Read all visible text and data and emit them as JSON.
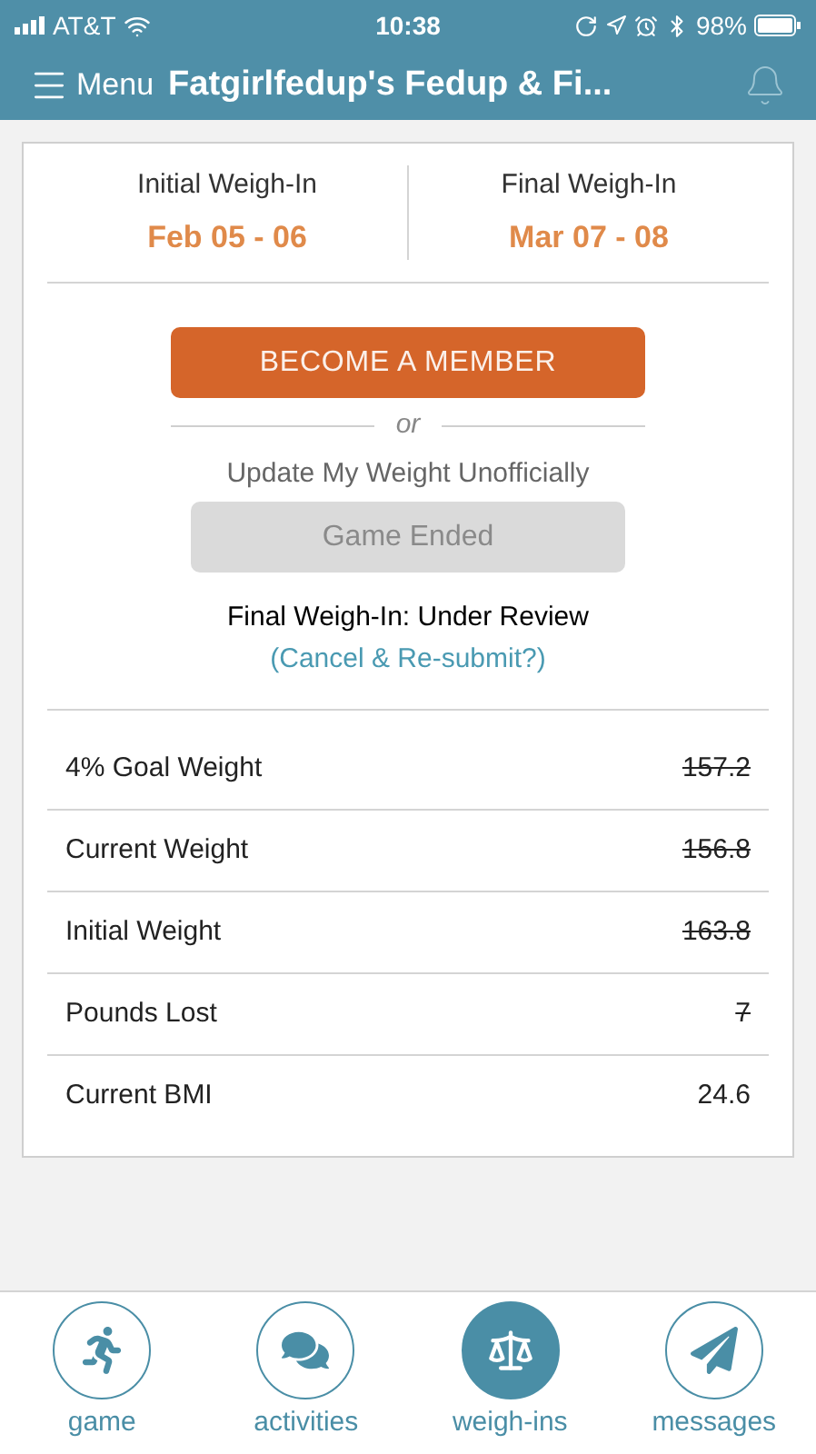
{
  "status_bar": {
    "carrier": "AT&T",
    "time": "10:38",
    "battery": "98%"
  },
  "header": {
    "menu_label": "Menu",
    "title": "Fatgirlfedup's Fedup & Fi..."
  },
  "weigh_ins": [
    {
      "label": "Initial Weigh-In",
      "dates": "Feb 05 - 06"
    },
    {
      "label": "Final Weigh-In",
      "dates": "Mar 07 - 08"
    }
  ],
  "member_button": "BECOME A MEMBER",
  "separator": "or",
  "update_label": "Update My Weight Unofficially",
  "update_button": {
    "label": "Game Ended",
    "disabled": true
  },
  "review_status": "Final Weigh-In: Under Review",
  "review_link": "(Cancel & Re-submit?)",
  "stats": [
    {
      "label": "4% Goal Weight",
      "value": "157.2",
      "struck": true
    },
    {
      "label": "Current Weight",
      "value": "156.8",
      "struck": true
    },
    {
      "label": "Initial Weight",
      "value": "163.8",
      "struck": true
    },
    {
      "label": "Pounds Lost",
      "value": "7",
      "struck": true
    },
    {
      "label": "Current BMI",
      "value": "24.6",
      "struck": false
    }
  ],
  "tabs": [
    {
      "kind": "game",
      "label": "game",
      "selected": false
    },
    {
      "kind": "activities",
      "label": "activities",
      "selected": false
    },
    {
      "kind": "weighins",
      "label": "weigh-ins",
      "selected": true
    },
    {
      "kind": "messages",
      "label": "messages",
      "selected": false
    }
  ]
}
